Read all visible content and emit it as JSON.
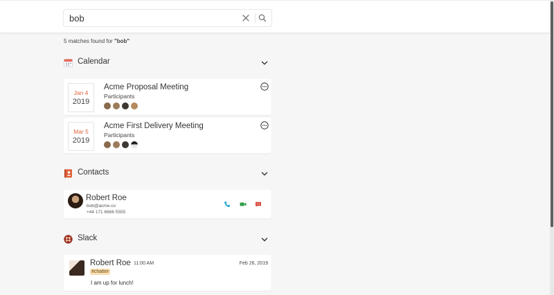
{
  "search": {
    "value": "bob",
    "placeholder": ""
  },
  "summary": {
    "prefix": "5 matches found for ",
    "query_display": "\"bob\""
  },
  "calendar": {
    "title": "Calendar",
    "events": [
      {
        "month_day": "Jan 4",
        "year": "2019",
        "title": "Acme Proposal Meeting",
        "participants_label": "Participants",
        "participant_colors": [
          "#8a6a4c",
          "#9c7b5a",
          "#3e3832",
          "#b48a5e"
        ]
      },
      {
        "month_day": "Mar 5",
        "year": "2019",
        "title": "Acme First Delivery Meeting",
        "participants_label": "Participants",
        "participant_colors": [
          "#8a6a4c",
          "#9c7b5a",
          "#3e3832",
          "#cfcfcf"
        ]
      }
    ]
  },
  "contacts": {
    "title": "Contacts",
    "items": [
      {
        "name": "Robert Roe",
        "email": "bob@acme.co",
        "phone": "+44 171 6666 5555"
      }
    ]
  },
  "slack": {
    "title": "Slack",
    "messages": [
      {
        "author": "Robert Roe",
        "time": "11:00 AM",
        "date": "Feb 26, 2019",
        "channel": "#chatter",
        "text": "I am up for lunch!"
      }
    ]
  },
  "colors": {
    "accent_date": "#e0623a",
    "phone_icon": "#26a6d1",
    "video_icon": "#2e9e48",
    "message_icon": "#d9433b",
    "calendar_icon": "#e8685a",
    "contacts_icon": "#e0623a",
    "slack_icon": "#9c2f21",
    "channel_badge": "#f8dfb2"
  }
}
